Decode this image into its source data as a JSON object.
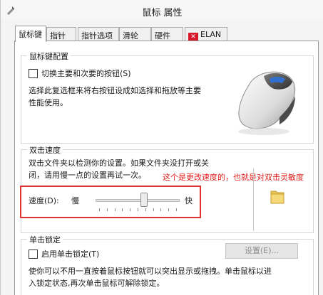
{
  "window": {
    "title": "鼠标 属性",
    "icon": "mouse-properties-icon"
  },
  "tabs": [
    {
      "label": "鼠标键",
      "active": true
    },
    {
      "label": "指针",
      "active": false
    },
    {
      "label": "指针选项",
      "active": false
    },
    {
      "label": "滑轮",
      "active": false
    },
    {
      "label": "硬件",
      "active": false
    },
    {
      "label": "ELAN",
      "active": false,
      "icon": "elan-logo-icon"
    }
  ],
  "button_config": {
    "title": "鼠标键配置",
    "switch_checkbox_label": "切换主要和次要的按钮(S)",
    "switch_checked": false,
    "description_lines": [
      "选择此复选框来将右按钮设成如选择和拖放等主要",
      "性能使用。"
    ],
    "image": "mouse-icon"
  },
  "double_click": {
    "title": "双击速度",
    "description_lines": [
      "双击文件夹以检测你的设置。如果文件夹没打开或关",
      "闭，请用慢一点的设置再试一次。"
    ],
    "speed_label": "速度(D):",
    "slow_label": "慢",
    "fast_label": "快",
    "speed_level": 0.58,
    "tick_count": 11,
    "test_folder": "folder-icon",
    "annotation": "这个是更改速度的，也就是对双击灵敏度"
  },
  "click_lock": {
    "title": "单击锁定",
    "checkbox_label": "启用单击锁定(T)",
    "checked": false,
    "settings_button": "设置(E)...",
    "settings_enabled": false,
    "description_lines": [
      "使你可以不用一直按着鼠标按钮就可以突出显示或拖拽。单击鼠标以进",
      "入锁定状态,再次单击鼠标可解除锁定。"
    ]
  },
  "colors": {
    "annotation": "#e23232",
    "panel_bg": "#ffffff",
    "window_bg": "#f4f4f4"
  }
}
